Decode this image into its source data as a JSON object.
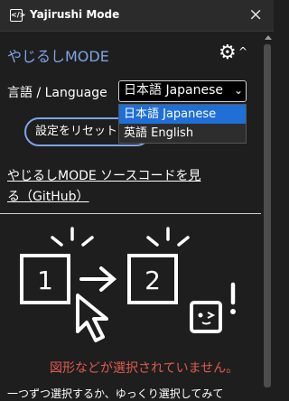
{
  "window": {
    "title": "Yajirushi Mode",
    "close_glyph": "×",
    "app_icon": "</>"
  },
  "panel": {
    "heading": "やじるしMODE",
    "gear_icon": "⚙",
    "gear_caret": "^"
  },
  "language": {
    "label": "言語 / Language",
    "selected": "日本語 Japanese",
    "options": [
      "日本語 Japanese",
      "英語 English"
    ]
  },
  "reset_button": {
    "label": "設定をリセットす"
  },
  "source_link": {
    "label": "やじるしMODE ソースコードを見る（GitHub）"
  },
  "illustration": {
    "box_left": "1",
    "box_right": "2"
  },
  "status": {
    "no_selection": "図形などが選択されていません。",
    "hint": "一つずつ選択するか、ゆっくり選択してみて"
  }
}
